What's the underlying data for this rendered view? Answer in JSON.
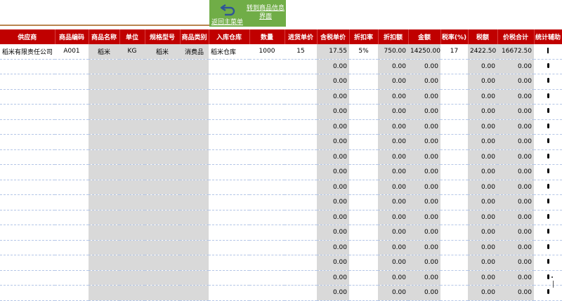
{
  "nav": {
    "back_label": "返回主菜单",
    "goto_label": "转到商品信息界面"
  },
  "colors": {
    "header_bg": "#c00000",
    "nav_bg": "#70ad47",
    "shade": "#d9d9d9"
  },
  "headers": [
    "供应商",
    "商品编码",
    "商品名称",
    "单位",
    "规格型号",
    "商品类别",
    "入库仓库",
    "数量",
    "进货单价",
    "含税单价",
    "折扣率",
    "折扣额",
    "金额",
    "税率(%)",
    "税额",
    "价税合计",
    "统计辅助"
  ],
  "first_row": [
    "稻米有限责任公司",
    "A001",
    "稻米",
    "KG",
    "稻米",
    "消费品",
    "稻米仓库",
    "1000",
    "15",
    "17.55",
    "5%",
    "750.00",
    "14250.00",
    "17",
    "2422.50",
    "16672.50",
    ""
  ],
  "empty_row_value": "0.00",
  "empty_row_count": 16
}
